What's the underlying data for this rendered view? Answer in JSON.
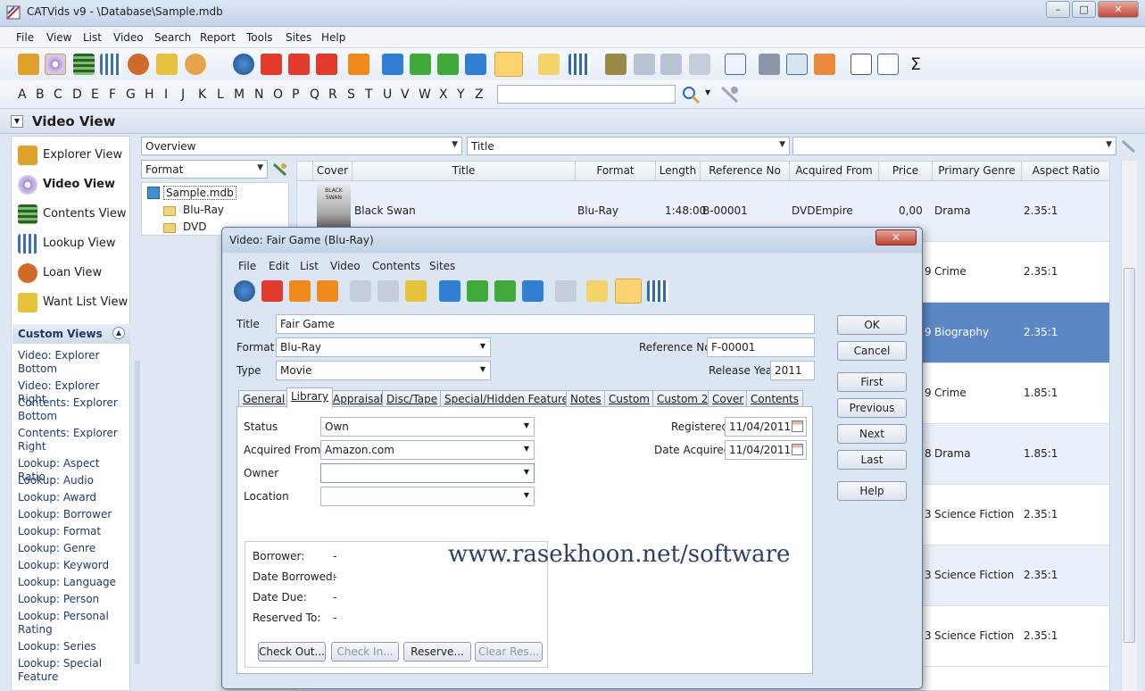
{
  "window": {
    "title": "CATVids v9 - \\Database\\Sample.mdb",
    "minimize": "–",
    "maximize": "□",
    "close": "✕"
  },
  "menu": [
    "File",
    "View",
    "List",
    "Video",
    "Search",
    "Report",
    "Tools",
    "Sites",
    "Help"
  ],
  "alphabet": [
    "A",
    "B",
    "C",
    "D",
    "E",
    "F",
    "G",
    "H",
    "I",
    "J",
    "K",
    "L",
    "M",
    "N",
    "O",
    "P",
    "Q",
    "R",
    "S",
    "T",
    "U",
    "V",
    "W",
    "X",
    "Y",
    "Z"
  ],
  "search": {
    "value": ""
  },
  "video_view_title": "Video View",
  "views": [
    {
      "label": "Explorer View",
      "icon": "house-icon",
      "color": "#e0a22c"
    },
    {
      "label": "Video View",
      "icon": "disc-icon",
      "color": "#8f6cc2"
    },
    {
      "label": "Contents View",
      "icon": "film-icon",
      "color": "#3a7a3a"
    },
    {
      "label": "Lookup View",
      "icon": "grid-icon",
      "color": "#3c6fb5"
    },
    {
      "label": "Loan View",
      "icon": "people-icon",
      "color": "#d06b2a"
    },
    {
      "label": "Want List View",
      "icon": "list-icon",
      "color": "#d8b52a"
    }
  ],
  "custom_views_title": "Custom Views",
  "custom_views": [
    "Video: Explorer Bottom",
    "Video: Explorer Right",
    "Contents: Explorer Bottom",
    "Contents: Explorer Right",
    "Lookup: Aspect Ratio",
    "Lookup: Audio",
    "Lookup: Award",
    "Lookup: Borrower",
    "Lookup: Format",
    "Lookup: Genre",
    "Lookup: Keyword",
    "Lookup: Language",
    "Lookup: Person",
    "Lookup: Personal Rating",
    "Lookup: Series",
    "Lookup: Special Feature"
  ],
  "filters": {
    "overview": "Overview",
    "title": "Title",
    "third": "",
    "format": "Format"
  },
  "tree": {
    "root": "Sample.mdb",
    "children": [
      "Blu-Ray",
      "DVD"
    ]
  },
  "grid": {
    "columns": [
      "Cover",
      "Title",
      "Format",
      "Length",
      "Reference No",
      "Acquired From",
      "Price",
      "Primary Genre",
      "Aspect Ratio"
    ],
    "rows": [
      {
        "cover": "BLACK SWAN",
        "title": "Black Swan",
        "format": "Blu-Ray",
        "length": "1:48:00",
        "ref": "B-00001",
        "acquired": "DVDEmpire",
        "price": "0,00",
        "genre": "Drama",
        "aspect": "2.35:1"
      },
      {
        "price_tail": "9",
        "genre": "Crime",
        "aspect": "2.35:1"
      },
      {
        "price_tail": "9",
        "genre": "Biography",
        "aspect": "2.35:1"
      },
      {
        "price_tail": "9",
        "genre": "Crime",
        "aspect": "1.85:1"
      },
      {
        "price_tail": "8",
        "genre": "Drama",
        "aspect": "1.85:1"
      },
      {
        "price_tail": "3",
        "genre": "Science Fiction",
        "aspect": "2.35:1"
      },
      {
        "price_tail": "3",
        "genre": "Science Fiction",
        "aspect": "2.35:1"
      },
      {
        "price_tail": "3",
        "genre": "Science Fiction",
        "aspect": "2.35:1"
      }
    ]
  },
  "dialog": {
    "title": "Video: Fair Game (Blu-Ray)",
    "close": "✕",
    "menu": [
      "File",
      "Edit",
      "List",
      "Video",
      "Contents",
      "Sites"
    ],
    "labels": {
      "title": "Title",
      "format": "Format",
      "type": "Type",
      "reference": "Reference No",
      "release_year": "Release Year"
    },
    "values": {
      "title": "Fair Game",
      "format": "Blu-Ray",
      "type": "Movie",
      "reference": "F-00001",
      "release_year": "2011"
    },
    "tabs": [
      "General",
      "Library",
      "Appraisal",
      "Disc/Tape",
      "Special/Hidden Features",
      "Notes",
      "Custom",
      "Custom 2",
      "Cover",
      "Contents"
    ],
    "library": {
      "status_label": "Status",
      "status": "Own",
      "acquired_label": "Acquired From",
      "acquired": "Amazon.com",
      "owner_label": "Owner",
      "owner": "",
      "location_label": "Location",
      "location": "",
      "registered_label": "Registered",
      "registered": "11/04/2011",
      "date_acquired_label": "Date Acquired",
      "date_acquired": "11/04/2011"
    },
    "loan": {
      "borrower_label": "Borrower:",
      "borrower": "-",
      "date_borrowed_label": "Date Borrowed:",
      "date_borrowed": "-",
      "date_due_label": "Date Due:",
      "date_due": "-",
      "reserved_label": "Reserved To:",
      "reserved": "-",
      "buttons": [
        "Check Out...",
        "Check In...",
        "Reserve...",
        "Clear Res..."
      ]
    },
    "side_buttons": [
      "OK",
      "Cancel",
      "First",
      "Previous",
      "Next",
      "Last",
      "Help"
    ]
  },
  "watermark": "www.rasekhoon.net/software",
  "colors": {
    "selected_row": "#5b87c4",
    "alt_row": "#e9f0f9",
    "accent": "#2e6bbd"
  }
}
